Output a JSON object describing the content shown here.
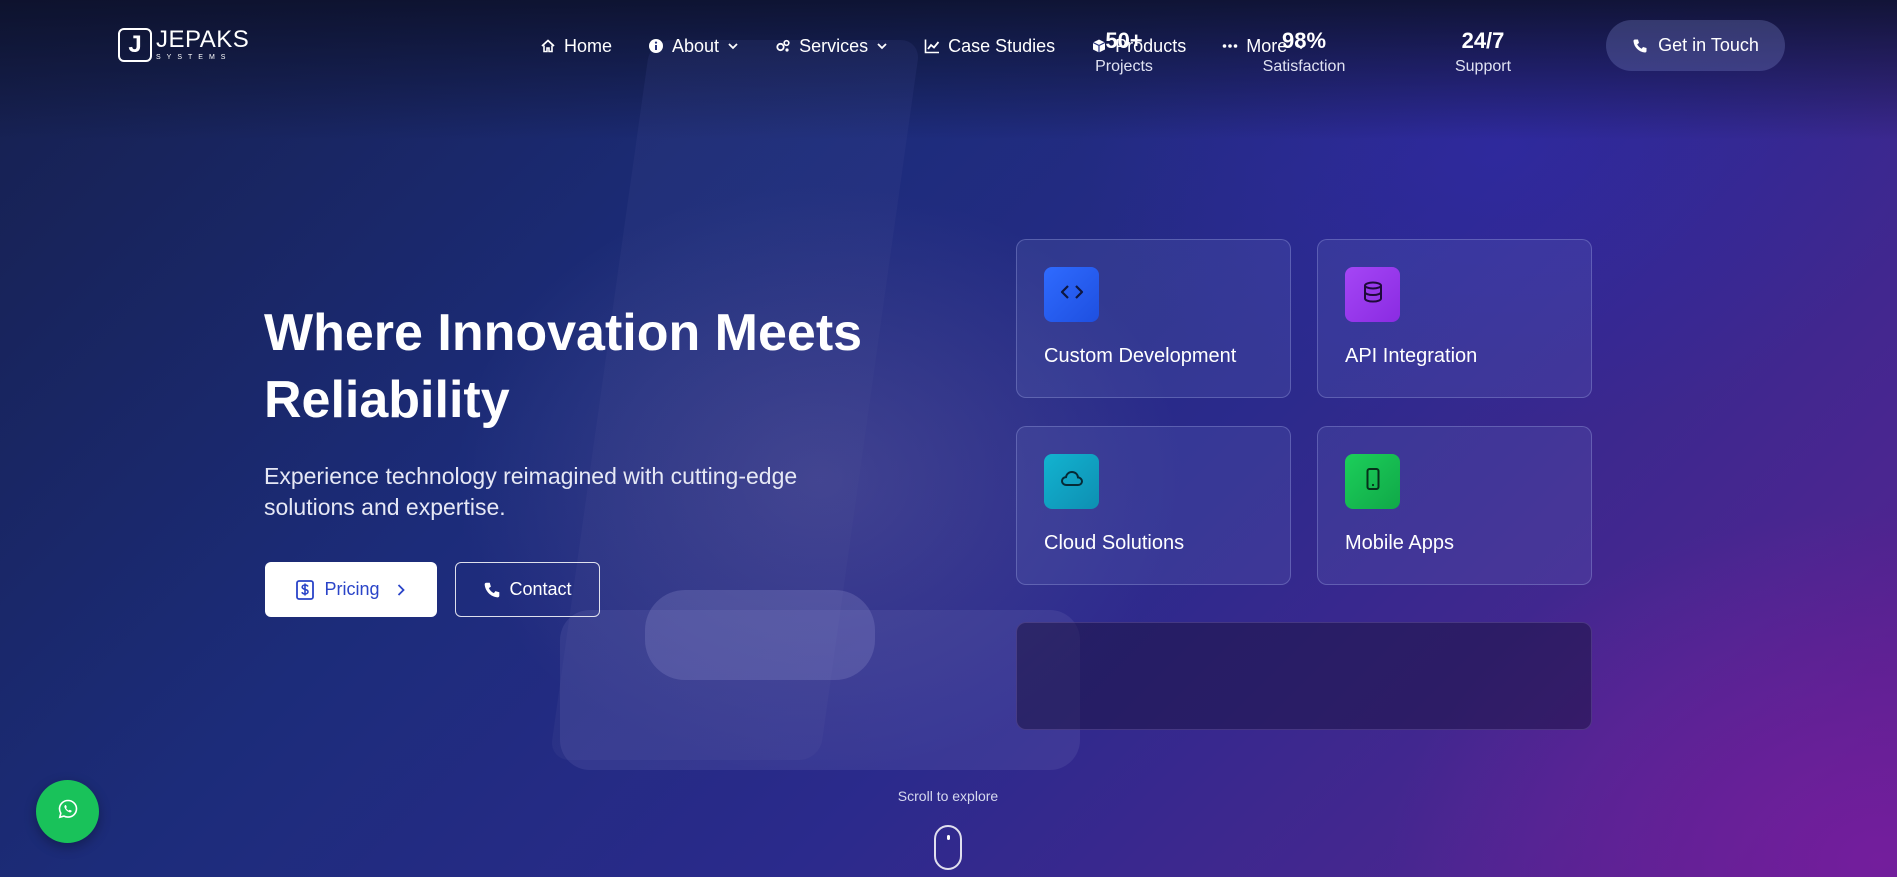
{
  "brand": {
    "logo_letter": "J",
    "name": "JEPAKS",
    "tagline": "SYSTEMS"
  },
  "nav": {
    "items": [
      {
        "label": "Home",
        "icon": "home-icon"
      },
      {
        "label": "About",
        "icon": "info-icon",
        "dropdown": true
      },
      {
        "label": "Services",
        "icon": "gears-icon",
        "dropdown": true
      },
      {
        "label": "Case Studies",
        "icon": "chart-line-icon"
      },
      {
        "label": "Products",
        "icon": "box-icon"
      },
      {
        "label": "More",
        "icon": "ellipsis-icon",
        "dropdown": true
      }
    ],
    "cta_label": "Get in Touch"
  },
  "hero": {
    "title_line1": "Where Innovation Meets",
    "title_line2": "Reliability",
    "subtitle_line1": "Experience technology reimagined with cutting-edge",
    "subtitle_line2": "solutions and expertise.",
    "pricing_label": "Pricing",
    "contact_label": "Contact"
  },
  "services": [
    {
      "label": "Custom Development",
      "icon": "code-icon",
      "color_from": "#2f6bff",
      "color_to": "#1e4fe0"
    },
    {
      "label": "API Integration",
      "icon": "database-icon",
      "color_from": "#a546f5",
      "color_to": "#8a2be2"
    },
    {
      "label": "Cloud Solutions",
      "icon": "cloud-icon",
      "color_from": "#12b3d0",
      "color_to": "#0e8fb2"
    },
    {
      "label": "Mobile Apps",
      "icon": "mobile-icon",
      "color_from": "#1ccf5a",
      "color_to": "#10a848"
    }
  ],
  "stats": [
    {
      "value": "50+",
      "caption": "Projects"
    },
    {
      "value": "98%",
      "caption": "Satisfaction"
    },
    {
      "value": "24/7",
      "caption": "Support"
    }
  ],
  "scroll_label": "Scroll to explore",
  "colors": {
    "whatsapp": "#19c25a",
    "pricing_text": "#2a44c8"
  }
}
